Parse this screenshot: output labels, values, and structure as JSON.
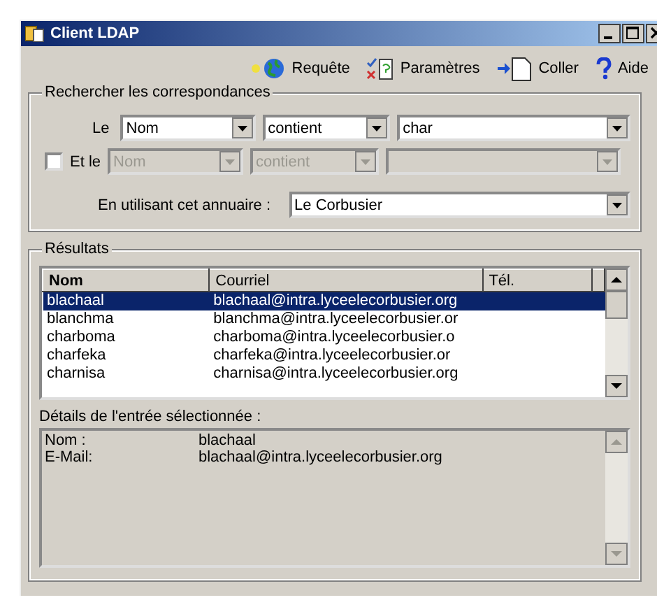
{
  "window": {
    "title": "Client LDAP"
  },
  "toolbar": [
    {
      "kind": "query",
      "label": "Requête"
    },
    {
      "kind": "settings",
      "label": "Paramètres"
    },
    {
      "kind": "paste",
      "label": "Coller"
    },
    {
      "kind": "help",
      "label": "Aide"
    }
  ],
  "search": {
    "title": "Rechercher les correspondances",
    "row1": {
      "label": "Le",
      "attribute": "Nom",
      "operator": "contient",
      "value": "char"
    },
    "row2": {
      "checked": false,
      "label": "Et le",
      "attribute": "Nom",
      "operator": "contient",
      "disabled": true
    },
    "directory_label": "En utilisant cet annuaire :",
    "directory": "Le Corbusier"
  },
  "results": {
    "title": "Résultats",
    "columns": [
      "Nom",
      "Courriel",
      "Tél."
    ],
    "rows": [
      {
        "cells": [
          "blachaal",
          "blachaal@intra.lyceelecorbusier.org"
        ],
        "selected": true
      },
      {
        "cells": [
          "blanchma",
          "blanchma@intra.lyceelecorbusier.or"
        ],
        "selected": false
      },
      {
        "cells": [
          "charboma",
          "charboma@intra.lyceelecorbusier.o"
        ],
        "selected": false
      },
      {
        "cells": [
          "charfeka",
          "charfeka@intra.lyceelecorbusier.or"
        ],
        "selected": false
      },
      {
        "cells": [
          "charnisa",
          "charnisa@intra.lyceelecorbusier.org"
        ],
        "selected": false
      }
    ]
  },
  "details": {
    "title": "Détails de l'entrée sélectionnée :",
    "fields": [
      {
        "label": "Nom :",
        "value": "blachaal"
      },
      {
        "label": "E-Mail:",
        "value": "blachaal@intra.lyceelecorbusier.org"
      }
    ]
  }
}
